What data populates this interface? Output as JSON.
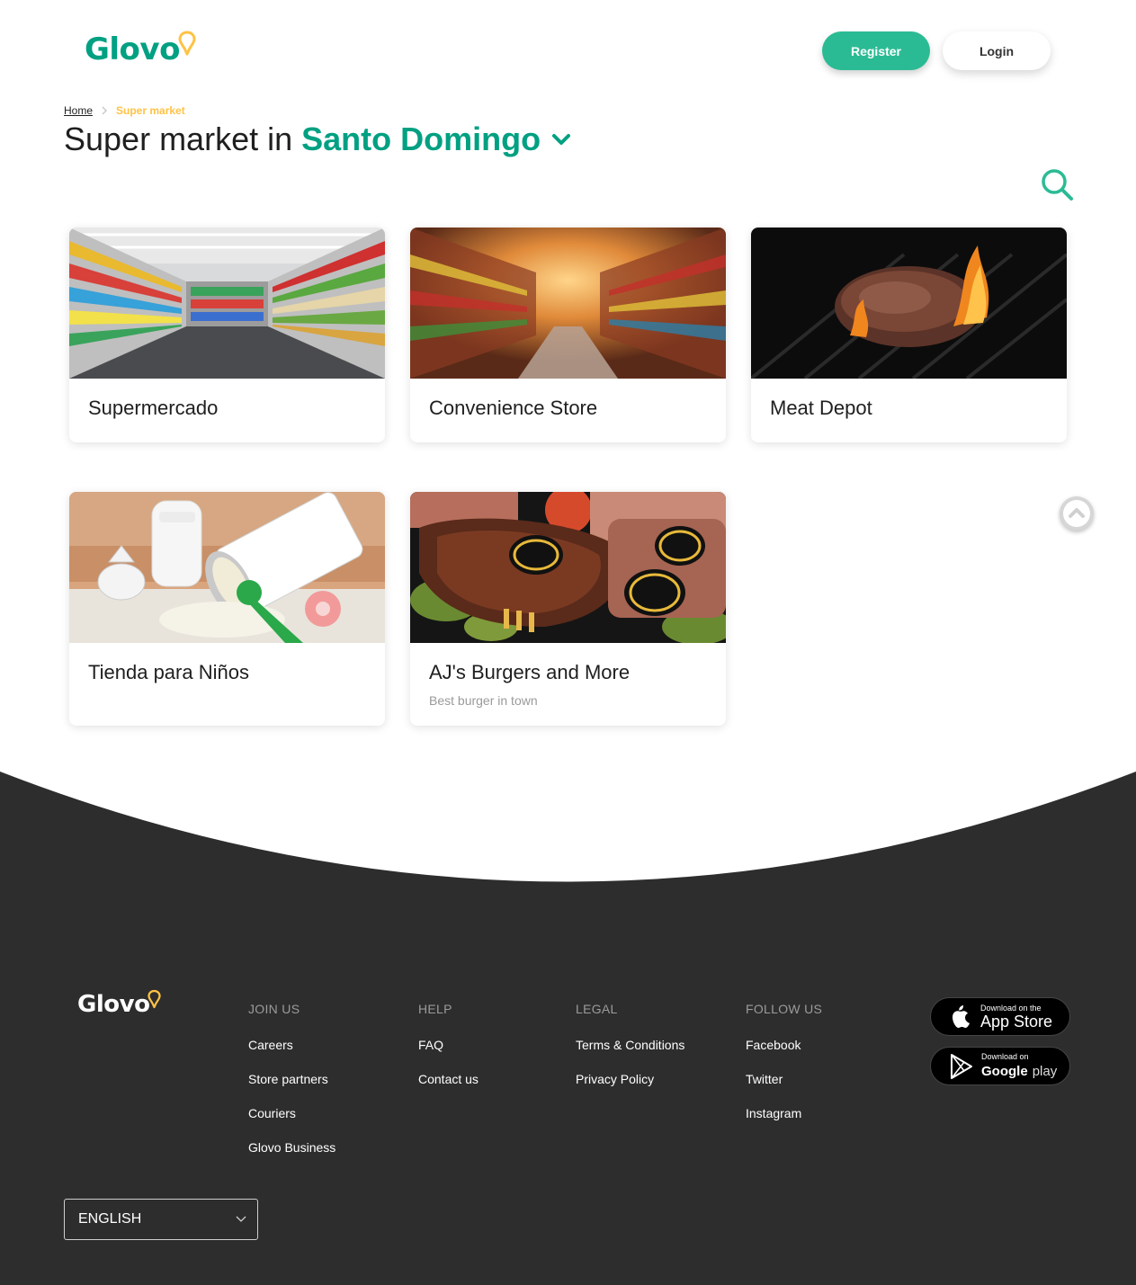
{
  "header": {
    "logo": "Glovo",
    "register_label": "Register",
    "login_label": "Login"
  },
  "breadcrumb": {
    "home": "Home",
    "current": "Super market"
  },
  "title": {
    "prefix": "Super market in",
    "city": "Santo Domingo"
  },
  "stores": [
    {
      "name": "Supermercado",
      "description": ""
    },
    {
      "name": "Convenience Store",
      "description": ""
    },
    {
      "name": "Meat Depot",
      "description": ""
    },
    {
      "name": "Tienda para Niños",
      "description": ""
    },
    {
      "name": "AJ's Burgers and More",
      "description": "Best burger in town"
    }
  ],
  "footer": {
    "logo": "Glovo",
    "columns": [
      {
        "heading": "JOIN US",
        "links": [
          "Careers",
          "Store partners",
          "Couriers",
          "Glovo Business"
        ]
      },
      {
        "heading": "HELP",
        "links": [
          "FAQ",
          "Contact us"
        ]
      },
      {
        "heading": "LEGAL",
        "links": [
          "Terms & Conditions",
          "Privacy Policy"
        ]
      },
      {
        "heading": "FOLLOW US",
        "links": [
          "Facebook",
          "Twitter",
          "Instagram"
        ]
      }
    ],
    "app_store": {
      "small": "Download on the",
      "big": "App Store"
    },
    "google_play": {
      "small": "Download on",
      "big_bold": "Google",
      "big_light": "play"
    },
    "language": "ENGLISH"
  },
  "colors": {
    "brand_green": "#00a082",
    "button_green": "#2bbb94",
    "brand_yellow": "#ffc244",
    "footer_bg": "#2d2d2d"
  },
  "icons": [
    "pin-icon",
    "chevron-down-icon",
    "search-icon",
    "chevron-up-icon",
    "apple-icon",
    "google-play-icon"
  ]
}
